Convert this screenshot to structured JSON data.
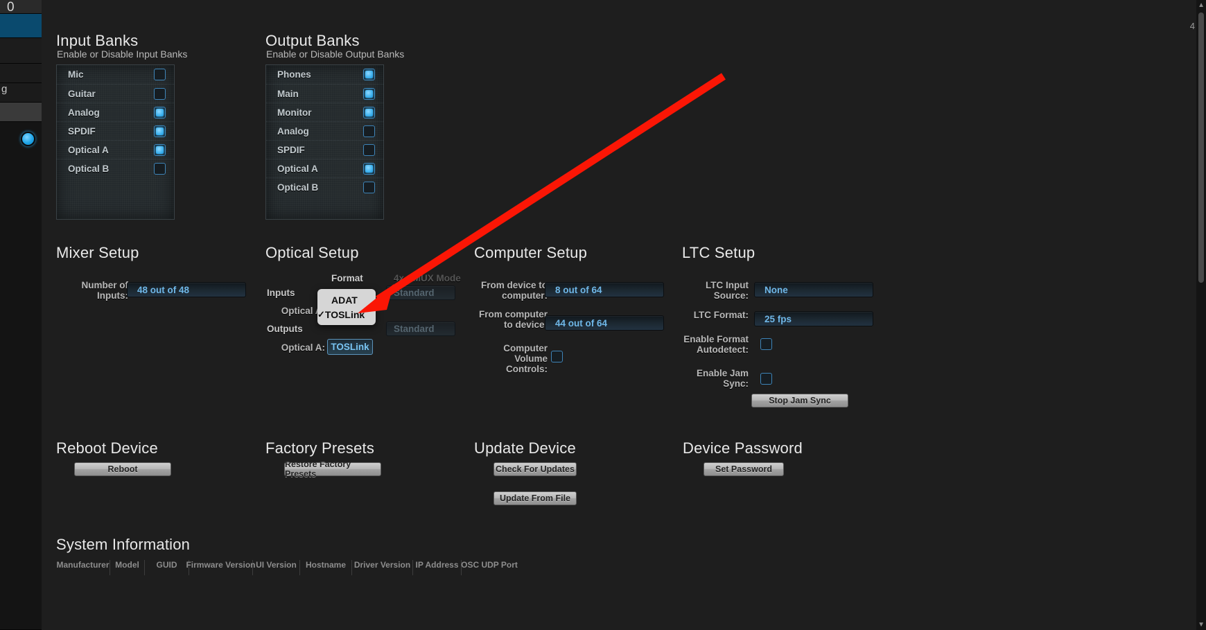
{
  "sidebar": {
    "top_fragment": "0",
    "mid_fragment": "g"
  },
  "input_banks": {
    "title": "Input Banks",
    "subtitle": "Enable or Disable Input Banks",
    "rows": [
      {
        "label": "Mic",
        "checked": false
      },
      {
        "label": "Guitar",
        "checked": false
      },
      {
        "label": "Analog",
        "checked": true
      },
      {
        "label": "SPDIF",
        "checked": true
      },
      {
        "label": "Optical A",
        "checked": true
      },
      {
        "label": "Optical B",
        "checked": false
      }
    ]
  },
  "output_banks": {
    "title": "Output Banks",
    "subtitle": "Enable or Disable Output Banks",
    "rows": [
      {
        "label": "Phones",
        "checked": true
      },
      {
        "label": "Main",
        "checked": true
      },
      {
        "label": "Monitor",
        "checked": true
      },
      {
        "label": "Analog",
        "checked": false
      },
      {
        "label": "SPDIF",
        "checked": false
      },
      {
        "label": "Optical A",
        "checked": true
      },
      {
        "label": "Optical B",
        "checked": false
      }
    ]
  },
  "mixer_setup": {
    "title": "Mixer Setup",
    "number_of_inputs_label": "Number of\nInputs:",
    "number_of_inputs_value": "48 out of 48"
  },
  "optical_setup": {
    "title": "Optical Setup",
    "format_header": "Format",
    "smux_header": "4x SMUX Mode",
    "inputs_header": "Inputs",
    "outputs_header": "Outputs",
    "input_optical_a_label": "Optical A:",
    "output_optical_a_label": "Optical A:",
    "input_smux_value": "Standard",
    "output_smux_value": "Standard",
    "output_format_value": "TOSLink",
    "menu": {
      "items": [
        {
          "label": "ADAT",
          "checked": false
        },
        {
          "label": "TOSLink",
          "checked": true
        }
      ],
      "check_glyph": "✓"
    }
  },
  "computer_setup": {
    "title": "Computer Setup",
    "from_device_label": "From device to\ncomputer:",
    "from_device_value": "8 out of 64",
    "to_device_label": "From computer\nto device:",
    "to_device_value": "44 out of 64",
    "volume_controls_label": "Computer\nVolume\nControls:",
    "volume_controls_checked": false
  },
  "ltc_setup": {
    "title": "LTC Setup",
    "input_source_label": "LTC Input\nSource:",
    "input_source_value": "None",
    "format_label": "LTC Format:",
    "format_value": "25 fps",
    "autodetect_label": "Enable Format\nAutodetect:",
    "autodetect_checked": false,
    "jam_sync_label": "Enable Jam\nSync:",
    "jam_sync_checked": false,
    "stop_jam_sync_button": "Stop Jam Sync"
  },
  "reboot_device": {
    "title": "Reboot Device",
    "button": "Reboot"
  },
  "factory_presets": {
    "title": "Factory Presets",
    "button": "Restore Factory Presets"
  },
  "update_device": {
    "title": "Update Device",
    "check_button": "Check For Updates",
    "file_button": "Update From File"
  },
  "device_password": {
    "title": "Device Password",
    "button": "Set Password"
  },
  "system_information": {
    "title": "System Information",
    "columns": [
      "Manufacturer",
      "Model",
      "GUID",
      "Firmware Version",
      "UI Version",
      "Hostname",
      "Driver Version",
      "IP Address",
      "OSC UDP Port"
    ]
  },
  "annotation": {
    "color": "#fb1605"
  },
  "scrollbar": {
    "up_glyph": "▲",
    "down_glyph": "▼",
    "corner_number": "4"
  }
}
